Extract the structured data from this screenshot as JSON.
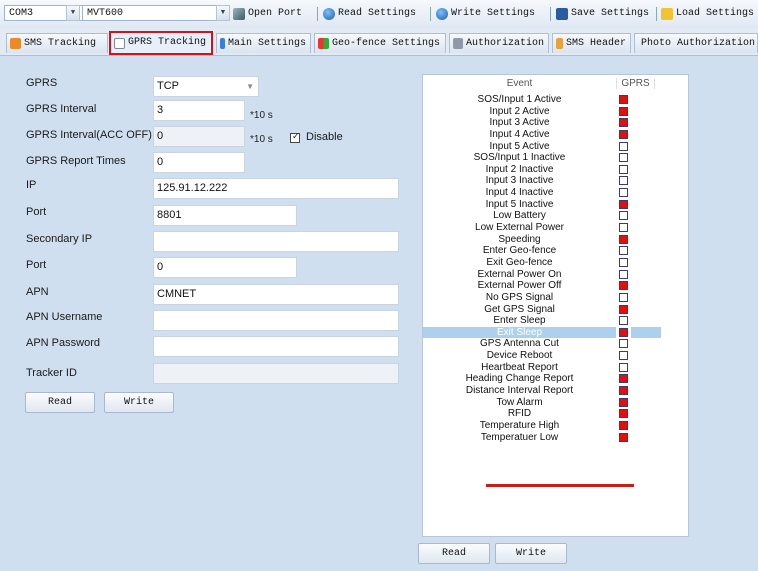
{
  "toolbar": {
    "port_combo": "COM3",
    "device_combo": "MVT600",
    "open_port": "Open Port",
    "read_settings": "Read Settings",
    "write_settings": "Write Settings",
    "save_settings": "Save Settings",
    "load_settings": "Load Settings"
  },
  "tabs": [
    "SMS Tracking",
    "GPRS Tracking",
    "Main Settings",
    "Geo-fence Settings",
    "Authorization",
    "SMS Header",
    "Photo Authorization"
  ],
  "form": {
    "gprs_label": "GPRS",
    "gprs_value": "TCP",
    "interval_label": "GPRS Interval",
    "interval_value": "3",
    "interval_unit": "*10 s",
    "interval_off_label": "GPRS Interval(ACC OFF)",
    "interval_off_value": "0",
    "interval_off_unit": "*10 s",
    "disable_label": "Disable",
    "report_times_label": "GPRS Report Times",
    "report_times_value": "0",
    "ip_label": "IP",
    "ip_value": "125.91.12.222",
    "port_label": "Port",
    "port_value": "8801",
    "secondary_ip_label": "Secondary IP",
    "secondary_ip_value": "",
    "port2_label": "Port",
    "port2_value": "0",
    "apn_label": "APN",
    "apn_value": "CMNET",
    "apn_user_label": "APN Username",
    "apn_user_value": "",
    "apn_pass_label": "APN Password",
    "apn_pass_value": "",
    "tracker_id_label": "Tracker ID",
    "tracker_id_value": "",
    "read_btn": "Read",
    "write_btn": "Write"
  },
  "events": {
    "col_event": "Event",
    "col_gprs": "GPRS",
    "rows": [
      {
        "name": "SOS/Input 1 Active",
        "checked": true
      },
      {
        "name": "Input 2 Active",
        "checked": true
      },
      {
        "name": "Input 3 Active",
        "checked": true
      },
      {
        "name": "Input 4 Active",
        "checked": true
      },
      {
        "name": "Input 5 Active",
        "checked": false
      },
      {
        "name": "SOS/Input 1 Inactive",
        "checked": false
      },
      {
        "name": "Input 2 Inactive",
        "checked": false
      },
      {
        "name": "Input 3 Inactive",
        "checked": false
      },
      {
        "name": "Input 4 Inactive",
        "checked": false
      },
      {
        "name": "Input 5 Inactive",
        "checked": true
      },
      {
        "name": "Low Battery",
        "checked": false
      },
      {
        "name": "Low External Power",
        "checked": false
      },
      {
        "name": "Speeding",
        "checked": true
      },
      {
        "name": "Enter Geo-fence",
        "checked": false
      },
      {
        "name": "Exit Geo-fence",
        "checked": false
      },
      {
        "name": "External Power On",
        "checked": false
      },
      {
        "name": "External Power Off",
        "checked": true
      },
      {
        "name": "No GPS Signal",
        "checked": false
      },
      {
        "name": "Get GPS Signal",
        "checked": true
      },
      {
        "name": "Enter Sleep",
        "checked": false
      },
      {
        "name": "Exit Sleep",
        "checked": true,
        "selected": true
      },
      {
        "name": "GPS Antenna Cut",
        "checked": false
      },
      {
        "name": "Device Reboot",
        "checked": false
      },
      {
        "name": "Heartbeat Report",
        "checked": false
      },
      {
        "name": "Heading Change Report",
        "checked": true
      },
      {
        "name": "Distance Interval Report",
        "checked": true
      },
      {
        "name": "Tow Alarm",
        "checked": true
      },
      {
        "name": "RFID",
        "checked": true
      },
      {
        "name": "Temperature High",
        "checked": true
      },
      {
        "name": "Temperatuer Low",
        "checked": true
      }
    ],
    "read_btn": "Read",
    "write_btn": "Write"
  },
  "colors": {
    "accent_red": "#d31317",
    "panel_bg": "#cfdff0",
    "selection": "#aed0ef"
  }
}
